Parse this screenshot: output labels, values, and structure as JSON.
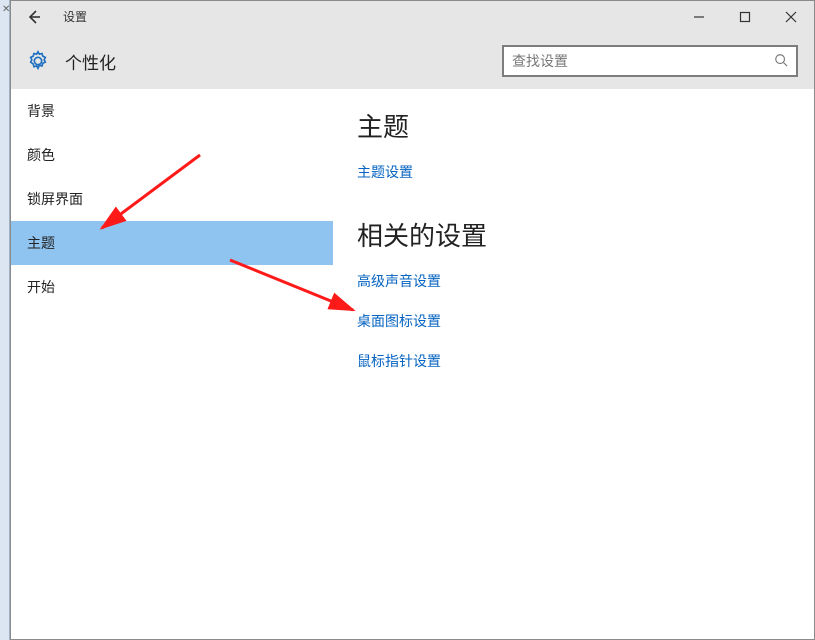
{
  "titlebar": {
    "title": "设置"
  },
  "header": {
    "title": "个性化",
    "search_placeholder": "查找设置"
  },
  "sidebar": {
    "items": [
      {
        "label": "背景"
      },
      {
        "label": "颜色"
      },
      {
        "label": "锁屏界面"
      },
      {
        "label": "主题",
        "selected": true
      },
      {
        "label": "开始"
      }
    ]
  },
  "content": {
    "heading1": "主题",
    "link_theme_settings": "主题设置",
    "heading2": "相关的设置",
    "link_sound": "高级声音设置",
    "link_desktop_icons": "桌面图标设置",
    "link_mouse": "鼠标指针设置"
  }
}
